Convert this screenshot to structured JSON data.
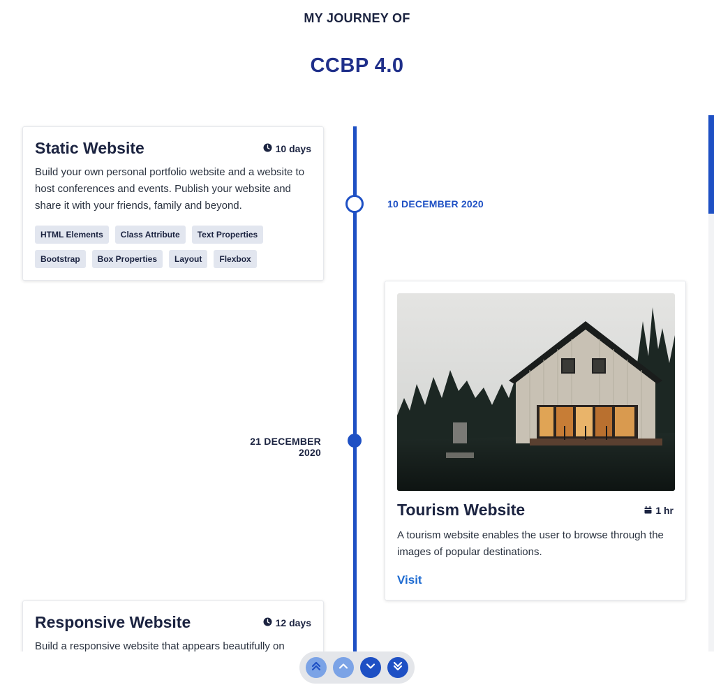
{
  "header": {
    "subtitle": "MY JOURNEY OF",
    "title": "CCBP 4.0"
  },
  "timeline": {
    "dates": [
      "10 DECEMBER 2020",
      "21 DECEMBER 2020"
    ]
  },
  "cards": [
    {
      "title": "Static Website",
      "duration": "10 days",
      "duration_icon": "clock-icon",
      "description": "Build your own personal portfolio website and a website to host conferences and events. Publish your website and share it with your friends, family and beyond.",
      "tags": [
        "HTML Elements",
        "Class Attribute",
        "Text Properties",
        "Bootstrap",
        "Box Properties",
        "Layout",
        "Flexbox"
      ]
    },
    {
      "title": "Tourism Website",
      "duration": "1 hr",
      "duration_icon": "calendar-icon",
      "description": "A tourism website enables the user to browse through the images of popular destinations.",
      "link": "Visit",
      "image": "house-at-dusk-photo"
    },
    {
      "title": "Responsive Website",
      "duration": "12 days",
      "duration_icon": "clock-icon",
      "description": "Build a responsive website that appears beautifully on"
    }
  ],
  "nav": {
    "buttons": [
      "scroll-to-top",
      "scroll-up",
      "scroll-down",
      "scroll-to-bottom"
    ]
  },
  "colors": {
    "accent": "#1e50c4",
    "heading": "#1f2f8a",
    "tag_bg": "#e2e6ef",
    "link": "#1e6bd1"
  }
}
